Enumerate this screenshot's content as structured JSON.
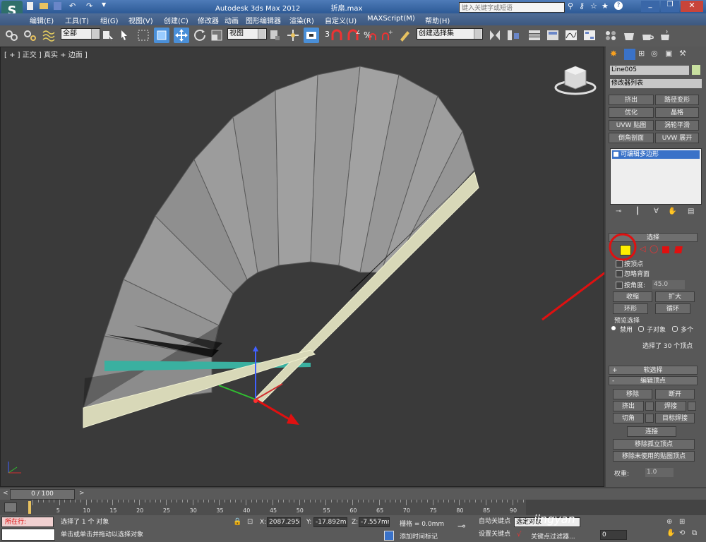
{
  "window": {
    "title": "Autodesk 3ds Max  2012",
    "file_name": "折扇.max",
    "search_placeholder": "键入关键字或短语"
  },
  "menu": {
    "items": [
      "编辑(E)",
      "工具(T)",
      "组(G)",
      "视图(V)",
      "创建(C)",
      "修改器",
      "动画",
      "图形编辑器",
      "渲染(R)",
      "自定义(U)",
      "MAXScript(M)",
      "帮助(H)"
    ]
  },
  "toolbar": {
    "selection_filter": "全部",
    "reference_coord": "视图",
    "snap_label": "3",
    "named_selection": "创建选择集"
  },
  "viewport": {
    "label": "[ + ] 正交 ] 真实 + 边面 ]"
  },
  "command_panel": {
    "object_name": "Line005",
    "modifier_list": "修改器列表",
    "modifier_buttons": [
      "挤出",
      "路径变形",
      "优化",
      "晶格",
      "UVW 贴图",
      "涡轮平滑",
      "倒角剖面",
      "UVW 展开"
    ],
    "stack_item": "可编辑多边形",
    "selection_rollout": "选择",
    "by_vertex": "按顶点",
    "ignore_backfacing": "忽略背面",
    "by_angle": "按角度:",
    "angle_value": "45.0",
    "shrink": "收缩",
    "grow": "扩大",
    "ring": "环形",
    "loop": "循环",
    "preview_selection": "预览选择",
    "preview_options": [
      "禁用",
      "子对象",
      "多个"
    ],
    "selection_status": "选择了 30 个顶点",
    "soft_selection": "软选择",
    "edit_vertices": "编辑顶点",
    "remove": "移除",
    "break": "断开",
    "extrude": "挤出",
    "weld": "焊接",
    "chamfer": "切角",
    "target_weld": "目标焊接",
    "connect": "连接",
    "remove_isolated": "移除孤立顶点",
    "remove_unused": "移除未使用的贴图顶点",
    "weight_label": "权重:",
    "weight_value": "1.0"
  },
  "timeline": {
    "frame_counter": "0 / 100",
    "ticks": [
      "5",
      "10",
      "15",
      "20",
      "25",
      "30",
      "35",
      "40",
      "45",
      "50",
      "55",
      "60",
      "65",
      "70",
      "75",
      "80",
      "85",
      "90"
    ]
  },
  "status": {
    "script_listener": "所在行:",
    "selected_objects": "选择了 1 个 对象",
    "prompt": "单击或单击并拖动以选择对象",
    "x_value": "2087.295m",
    "y_value": "-17.892mm",
    "z_value": "-7.557mm",
    "grid": "栅格 = 0.0mm",
    "auto_key": "自动关键点",
    "set_key": "设置关键点",
    "selected_dropdown": "选定对象",
    "key_filters": "关键点过滤器...",
    "add_time_tag": "添加时间标记",
    "frame_field": "0",
    "watermark": "jingyan"
  },
  "colors": {
    "vertex_active": "#ffee00",
    "annotation": "#e01010",
    "fan_paper": "#9a9a9a",
    "fan_rib": "#d8d8b8"
  }
}
